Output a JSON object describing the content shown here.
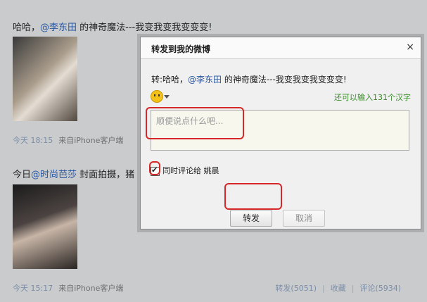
{
  "feed": {
    "post1": {
      "text_prefix": "哈哈，",
      "mention": "@李东田",
      "text_suffix": " 的神奇魔法---我变我变我变变变!",
      "meta_time": "今天  18:15",
      "meta_source": "来自iPhone客户端"
    },
    "post2": {
      "text_prefix": "今日",
      "mention": "@时尚芭莎",
      "text_suffix": " 封面拍摄，猪",
      "meta_time": "今天  15:17",
      "meta_source": "来自iPhone客户端",
      "repost_label": "转发(5051)",
      "favorite_label": "收藏",
      "comment_label": "评论(5934)"
    }
  },
  "dialog": {
    "title": "转发到我的微博",
    "close": "×",
    "quote_prefix": "转:哈哈，",
    "quote_mention": "@李东田",
    "quote_suffix": " 的神奇魔法---我变我变我变变变!",
    "remaining": "还可以输入131个汉字",
    "placeholder": "顺便说点什么吧...",
    "also_comment": "同时评论给 姚晨",
    "repost_button": "转发",
    "cancel_button": "取消"
  },
  "colors": {
    "accent_link": "#2a57a0",
    "highlight": "#d62828",
    "remaining_text": "#3a8a2a"
  }
}
